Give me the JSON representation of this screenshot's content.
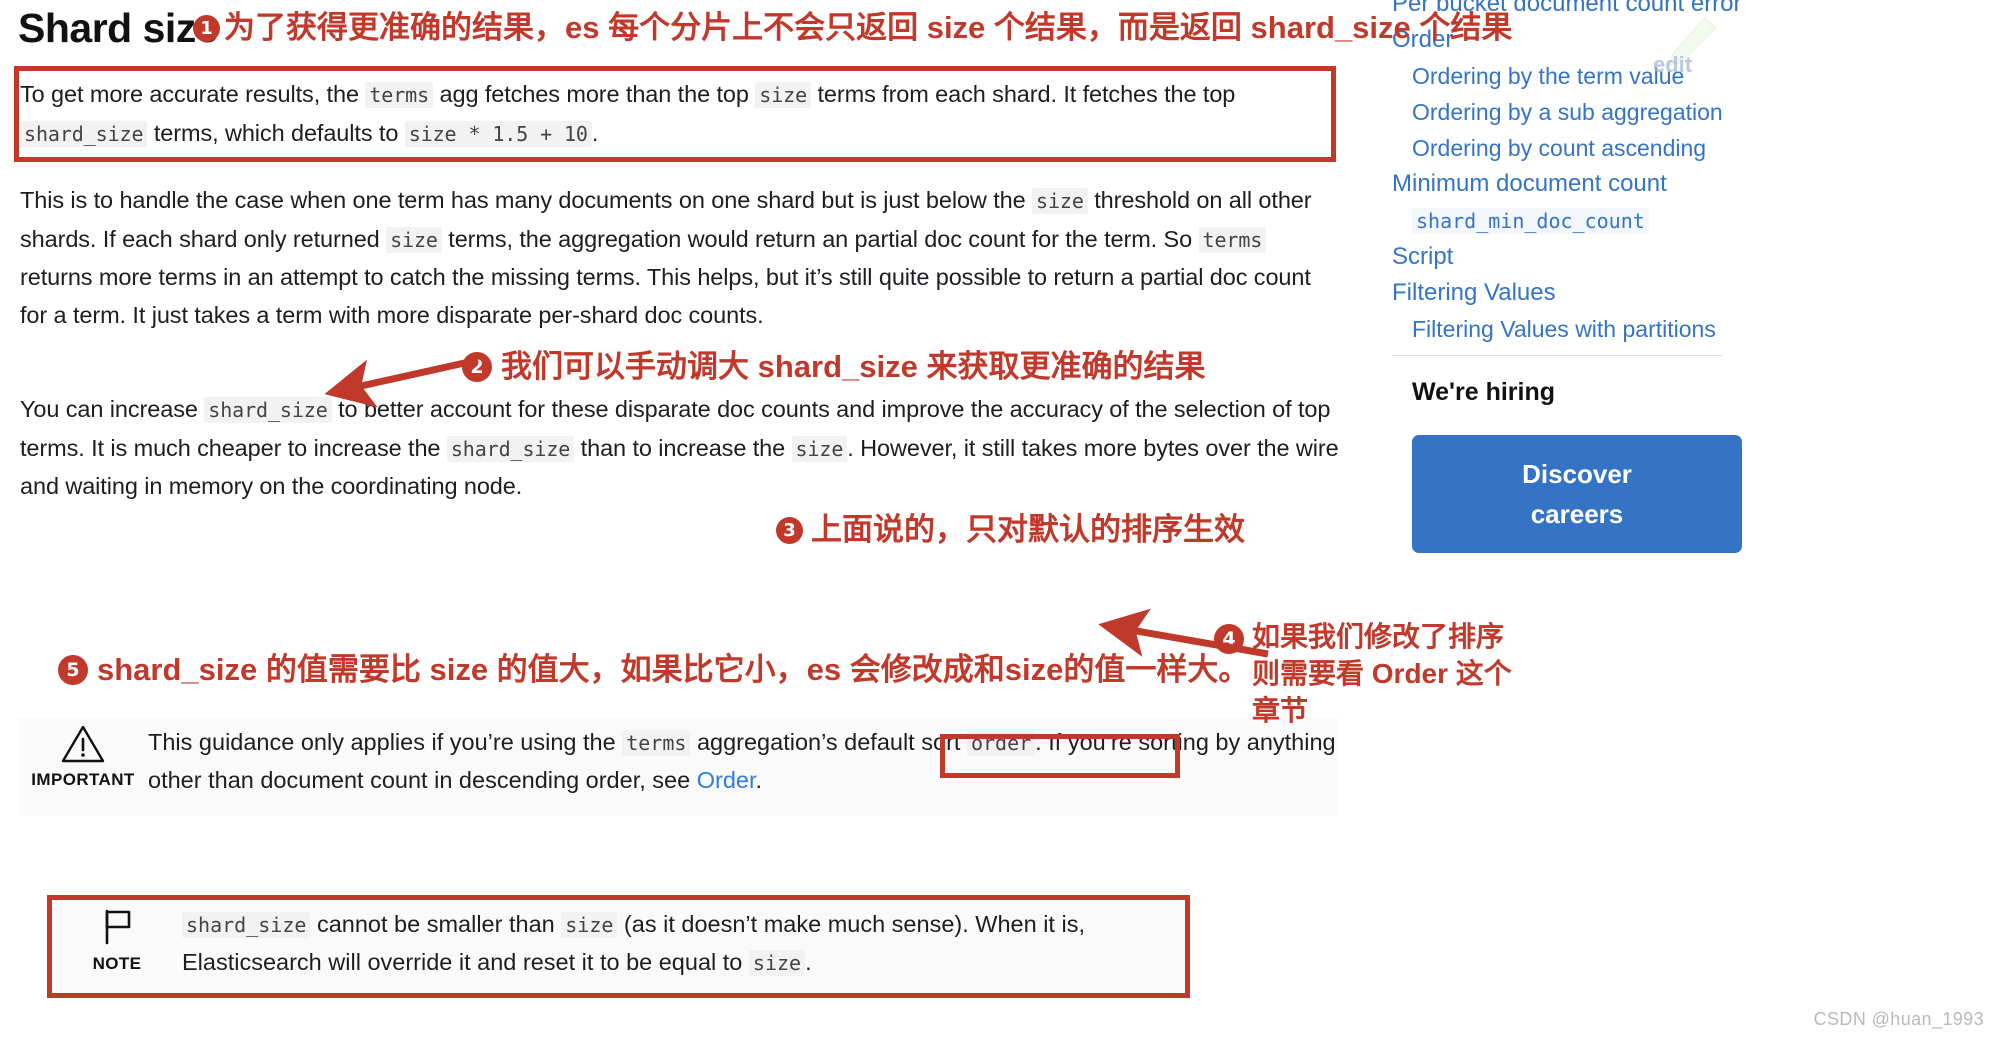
{
  "page": {
    "title": "Shard size",
    "edit_link": "edit",
    "watermark": "CSDN @huan_1993"
  },
  "content": {
    "paragraph1": {
      "parts": [
        {
          "t": "text",
          "v": "To get more accurate results, the "
        },
        {
          "t": "code",
          "v": "terms"
        },
        {
          "t": "text",
          "v": " agg fetches more than the top "
        },
        {
          "t": "code",
          "v": "size"
        },
        {
          "t": "text",
          "v": " terms from each shard. It fetches the top "
        },
        {
          "t": "code",
          "v": "shard_size"
        },
        {
          "t": "text",
          "v": " terms, which defaults to "
        },
        {
          "t": "code",
          "v": "size * 1.5 + 10"
        },
        {
          "t": "text",
          "v": "."
        }
      ]
    },
    "paragraph2": {
      "parts": [
        {
          "t": "text",
          "v": "This is to handle the case when one term has many documents on one shard but is just below the "
        },
        {
          "t": "code",
          "v": "size"
        },
        {
          "t": "text",
          "v": " threshold on all other shards. If each shard only returned "
        },
        {
          "t": "code",
          "v": "size"
        },
        {
          "t": "text",
          "v": " terms, the aggregation would return an partial doc count for the term. So "
        },
        {
          "t": "code",
          "v": "terms"
        },
        {
          "t": "text",
          "v": " returns more terms in an attempt to catch the missing terms. This helps, but it’s still quite possible to return a partial doc count for a term. It just takes a term with more disparate per-shard doc counts."
        }
      ]
    },
    "paragraph3": {
      "parts": [
        {
          "t": "text",
          "v": "You can increase "
        },
        {
          "t": "code",
          "v": "shard_size"
        },
        {
          "t": "text",
          "v": " to better account for these disparate doc counts and improve the accuracy of the selection of top terms. It is much cheaper to increase the "
        },
        {
          "t": "code",
          "v": "shard_size"
        },
        {
          "t": "text",
          "v": " than to increase the "
        },
        {
          "t": "code",
          "v": "size"
        },
        {
          "t": "text",
          "v": ". However, it still takes more bytes over the wire and waiting in memory on the coordinating node."
        }
      ]
    },
    "important": {
      "label": "IMPORTANT",
      "icon": "warning-triangle-icon",
      "parts": [
        {
          "t": "text",
          "v": "This guidance only applies if you’re using the "
        },
        {
          "t": "code",
          "v": "terms"
        },
        {
          "t": "text",
          "v": " aggregation’s default sort "
        },
        {
          "t": "code",
          "v": "order"
        },
        {
          "t": "text",
          "v": ". If you’re sorting by anything other than document count in descending order, see "
        },
        {
          "t": "link",
          "v": "Order"
        },
        {
          "t": "text",
          "v": "."
        }
      ]
    },
    "note": {
      "label": "NOTE",
      "icon": "flag-icon",
      "parts": [
        {
          "t": "code",
          "v": "shard_size"
        },
        {
          "t": "text",
          "v": " cannot be smaller than "
        },
        {
          "t": "code",
          "v": "size"
        },
        {
          "t": "text",
          "v": " (as it doesn’t make much sense). When it is, Elasticsearch will override it and reset it to be equal to "
        },
        {
          "t": "code",
          "v": "size"
        },
        {
          "t": "text",
          "v": "."
        }
      ]
    }
  },
  "annotations": [
    {
      "num": "1",
      "text": "为了获得更准确的结果，es 每个分片上不会只返回 size 个结果，而是返回 shard_size 个结果"
    },
    {
      "num": "2",
      "text": "我们可以手动调大 shard_size 来获取更准确的结果"
    },
    {
      "num": "3",
      "text": "上面说的，只对默认的排序生效"
    },
    {
      "num": "4",
      "text": "如果我们修改了排序\n则需要看 Order 这个\n章节"
    },
    {
      "num": "5",
      "text": "shard_size 的值需要比 size 的值大，如果比它小，es 会修改成和size的值一样大。"
    }
  ],
  "sidebar": {
    "toc": [
      {
        "label": "Per bucket document count error",
        "level": 1,
        "code": false
      },
      {
        "label": "Order",
        "level": 1,
        "code": false
      },
      {
        "label": "Ordering by the term value",
        "level": 2,
        "code": false
      },
      {
        "label": "Ordering by a sub aggregation",
        "level": 2,
        "code": false
      },
      {
        "label": "Ordering by count ascending",
        "level": 2,
        "code": false
      },
      {
        "label": "Minimum document count",
        "level": 1,
        "code": false
      },
      {
        "label": "shard_min_doc_count",
        "level": 2,
        "code": true
      },
      {
        "label": "Script",
        "level": 1,
        "code": false
      },
      {
        "label": "Filtering Values",
        "level": 1,
        "code": false
      },
      {
        "label": "Filtering Values with partitions",
        "level": 2,
        "code": false
      }
    ],
    "hiring_title": "We're hiring",
    "cta_line1": "Discover",
    "cta_line2": "careers"
  },
  "colors": {
    "annotation_red": "#c0392b",
    "link_blue": "#3573c4",
    "cta_blue": "#3573c4",
    "code_bg": "#f2f2f2"
  }
}
